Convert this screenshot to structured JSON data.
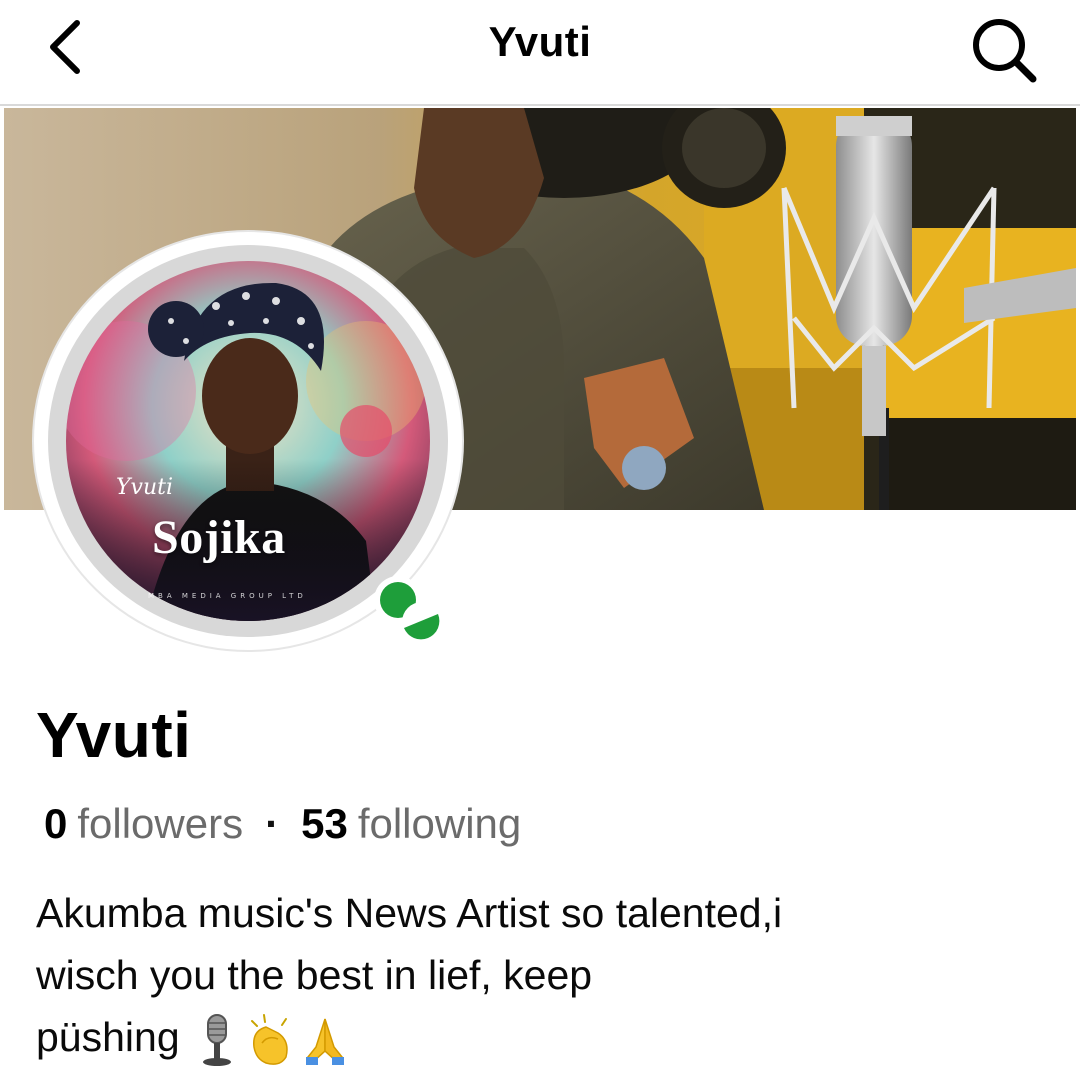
{
  "header": {
    "back_icon": "chevron-left-icon",
    "title": "Yvuti",
    "search_icon": "search-icon"
  },
  "cover": {
    "description_icon": "cover-photo"
  },
  "avatar": {
    "script_text": "Yvuti",
    "brand_text": "Sojika",
    "credit_text": "MBA MEDIA GROUP LTD",
    "online_status_color": "#1e9e3a"
  },
  "profile": {
    "name": "Yvuti",
    "followers_count": "0",
    "followers_label": "followers",
    "separator": "·",
    "following_count": "53",
    "following_label": "following",
    "bio_line1": "Akumba music's News Artist so talented,i",
    "bio_line2": "wisch you the best in lief, keep",
    "bio_line3": "püshing",
    "bio_emojis": [
      "microphone-icon",
      "clapping-hands-icon",
      "folded-hands-icon"
    ]
  },
  "colors": {
    "accent_green": "#1e9e3a",
    "muted_text": "#6b6b6b",
    "divider": "#d9d9d9"
  }
}
